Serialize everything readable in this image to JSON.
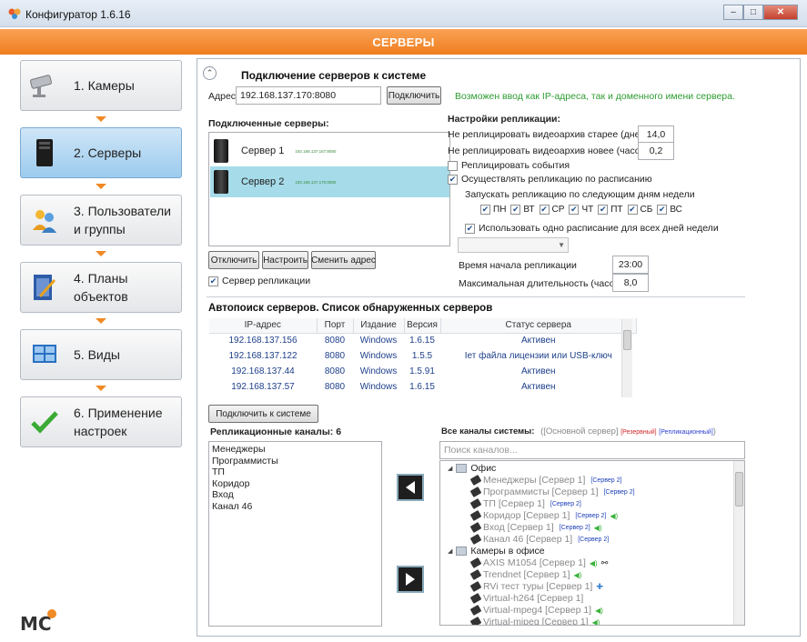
{
  "window": {
    "title": "Конфигуратор 1.6.16",
    "minimize": "–",
    "maximize": "□",
    "close": "✕"
  },
  "header": {
    "title": "СЕРВЕРЫ"
  },
  "sidebar": {
    "steps": [
      {
        "label": "1. Камеры",
        "icon": "camera-icon"
      },
      {
        "label": "2. Серверы",
        "icon": "server-icon"
      },
      {
        "label": "3. Пользователи и группы",
        "icon": "users-icon"
      },
      {
        "label": "4. Планы объектов",
        "icon": "plan-icon"
      },
      {
        "label": "5. Виды",
        "icon": "layout-icon"
      },
      {
        "label": "6. Применение настроек",
        "icon": "checkmark-icon"
      }
    ],
    "logo": "MC"
  },
  "connect": {
    "title": "Подключение серверов к системе",
    "address_label": "Адрес",
    "address_value": "192.168.137.170:8080",
    "connect_button": "Подключить",
    "hint": "Возможен ввод как IP-адреса, так и доменного имени сервера."
  },
  "connected": {
    "title": "Подключенные серверы:",
    "servers": [
      {
        "name": "Сервер 1",
        "address": "192.168.137.167:8080",
        "selected": false
      },
      {
        "name": "Сервер 2",
        "address": "192.168.137.170:8080",
        "selected": true
      }
    ],
    "disconnect_button": "Отключить",
    "configure_button": "Настроить",
    "change_address_button": "Сменить адрес",
    "replication_server_label": "Сервер репликации",
    "replication_server_checked": true
  },
  "replication": {
    "title": "Настройки репликации:",
    "older_label": "Не реплицировать видеоархив старее (дней)",
    "older_value": "14,0",
    "newer_label": "Не реплицировать видеоархив новее (часов)",
    "newer_value": "0,2",
    "events_label": "Реплицировать события",
    "events_checked": false,
    "schedule_label": "Осуществлять репликацию по расписанию",
    "schedule_checked": true,
    "days_label": "Запускать репликацию по следующим дням недели",
    "days": [
      "ПН",
      "ВТ",
      "СР",
      "ЧТ",
      "ПТ",
      "СБ",
      "ВС"
    ],
    "single_schedule_label": "Использовать одно расписание для всех дней недели",
    "single_schedule_checked": true,
    "start_time_label": "Время начала репликации",
    "start_time_value": "23:00",
    "max_duration_label": "Максимальная длительность (часов)",
    "max_duration_value": "8,0"
  },
  "autosearch": {
    "title": "Автопоиск серверов. Список обнаруженных серверов",
    "columns": [
      "IP-адрес",
      "Порт",
      "Издание",
      "Версия",
      "Статус сервера"
    ],
    "rows": [
      [
        "192.168.137.156",
        "8080",
        "Windows",
        "1.6.15",
        "Активен"
      ],
      [
        "192.168.137.122",
        "8080",
        "Windows",
        "1.5.5",
        "Іет файла лицензии или USB-ключ"
      ],
      [
        "192.168.137.44",
        "8080",
        "Windows",
        "1.5.91",
        "Активен"
      ],
      [
        "192.168.137.57",
        "8080",
        "Windows",
        "1.6.15",
        "Активен"
      ]
    ],
    "connect_button": "Подключить к системе"
  },
  "channels": {
    "replication_title": "Репликационные каналы:",
    "replication_count": "6",
    "replication_items": [
      "Менеджеры",
      "Программисты",
      "ТП",
      "Коридор",
      "Вход",
      "Канал 46"
    ],
    "all_title": "Все каналы системы:",
    "legend_open": "(",
    "legend_main": "[Основной сервер]",
    "legend_reserve": "[Резервный]",
    "legend_repl": "[Репликационный]",
    "legend_close": ")",
    "search_placeholder": "Поиск каналов...",
    "tree": [
      {
        "type": "group",
        "label": "Офис"
      },
      {
        "type": "item",
        "label": "Менеджеры [Сервер 1]",
        "extra": "[Сервер 2]"
      },
      {
        "type": "item",
        "label": "Программисты [Сервер 1]",
        "extra": "[Сервер 2]"
      },
      {
        "type": "item",
        "label": "ТП [Сервер 1]",
        "extra": "[Сервер 2]"
      },
      {
        "type": "item",
        "label": "Коридор [Сервер 1]",
        "extra": "[Сервер 2]",
        "sound": true
      },
      {
        "type": "item",
        "label": "Вход [Сервер 1]",
        "extra": "[Сервер 2]",
        "sound": true
      },
      {
        "type": "item",
        "label": "Канал 46 [Сервер 1]",
        "extra": "[Сервер 2]"
      },
      {
        "type": "group",
        "label": "Камеры в офисе"
      },
      {
        "type": "item",
        "label": "AXIS M1054 [Сервер 1]",
        "sound": true,
        "icon": "binoculars-icon"
      },
      {
        "type": "item",
        "label": "Trendnet [Сервер 1]",
        "sound": true
      },
      {
        "type": "item",
        "label": "RVi тест туры [Сервер 1]",
        "icon": "ptz-icon"
      },
      {
        "type": "item",
        "label": "Virtual-h264 [Сервер 1]"
      },
      {
        "type": "item",
        "label": "Virtual-mpeg4 [Сервер 1]",
        "sound": true
      },
      {
        "type": "item",
        "label": "Virtual-mjpeg [Сервер 1]",
        "sound": true
      }
    ]
  }
}
